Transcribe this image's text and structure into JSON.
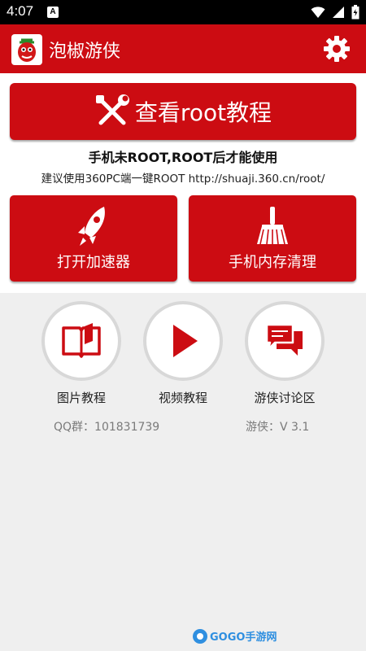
{
  "statusbar": {
    "time": "4:07",
    "notif_letter": "A"
  },
  "appbar": {
    "title": "泡椒游侠"
  },
  "main_button": {
    "label": "查看root教程"
  },
  "notice": {
    "main": "手机未ROOT,ROOT后才能使用",
    "sub": "建议使用360PC端一键ROOT http://shuaji.360.cn/root/"
  },
  "tiles": [
    {
      "label": "打开加速器",
      "icon": "rocket-icon"
    },
    {
      "label": "手机内存清理",
      "icon": "broom-icon"
    }
  ],
  "circles": [
    {
      "label": "图片教程",
      "icon": "book-icon"
    },
    {
      "label": "视频教程",
      "icon": "play-icon"
    },
    {
      "label": "游侠讨论区",
      "icon": "chat-icon"
    }
  ],
  "info": {
    "qq": "QQ群：101831739",
    "version": "游侠：V 3.1"
  },
  "watermark": {
    "text": "GOGO手游网"
  },
  "colors": {
    "brand_red": "#cc0c12",
    "background": "#efefef"
  }
}
